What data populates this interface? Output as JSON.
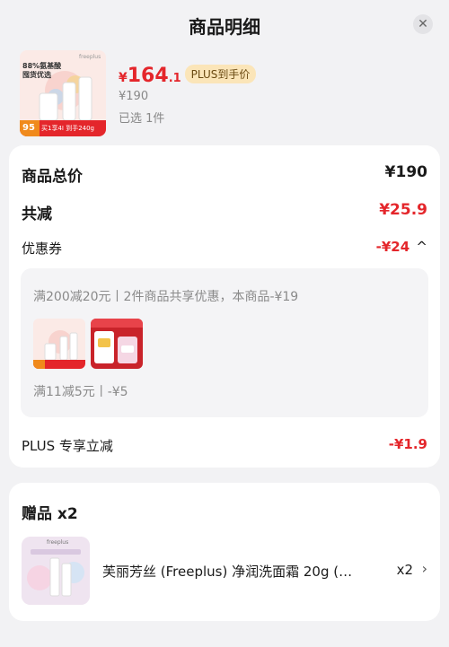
{
  "header": {
    "title": "商品明细",
    "close_symbol": "✕"
  },
  "product": {
    "thumb_promo": "88%氨基酸",
    "thumb_promo2": "囤货优选",
    "thumb_brand": "freeplus",
    "thumb_badge_num": "95",
    "thumb_badge_text": "买1享4I 到手240g",
    "price_yen": "¥",
    "price_main": "164",
    "price_dec": ".1",
    "plus_tag": "PLUS到手价",
    "original_price": "¥190",
    "selected": "已选 1件"
  },
  "summary": {
    "total_label": "商品总价",
    "total_value": "¥190",
    "reduce_label": "共减",
    "reduce_value": "¥25.9",
    "coupon_label": "优惠券",
    "coupon_value": "-¥24",
    "coupon_toggle": "^",
    "coupon_detail1": "满200减20元丨2件商品共享优惠，本商品-¥19",
    "coupon_detail2": "满11减5元丨-¥5",
    "plus_label": "PLUS 专享立减",
    "plus_value": "-¥1.9"
  },
  "gifts": {
    "title": "赠品 x2",
    "item_brand": "freeplus",
    "item_name": "芙丽芳丝 (Freeplus) 净润洗面霜 20g (…",
    "item_qty": "x2",
    "item_chevron": "›"
  },
  "colors": {
    "accent": "#e4262b",
    "plus_bg": "#fbe5b8",
    "bg": "#f2f2f4"
  }
}
